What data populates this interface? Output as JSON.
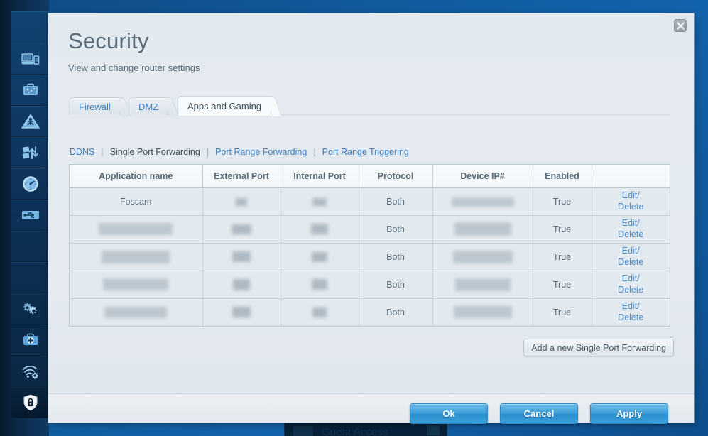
{
  "sidebar": {
    "items": [
      {
        "name": "device-list",
        "icon": "laptop-devices-icon",
        "label": "Device List"
      },
      {
        "name": "guest-access",
        "icon": "suitcase-icon",
        "label": "Guest Access"
      },
      {
        "name": "parental-controls",
        "icon": "parental-controls-icon",
        "label": "Parental Controls"
      },
      {
        "name": "media-prioritization",
        "icon": "media-prioritization-icon",
        "label": "Media Prioritization"
      },
      {
        "name": "speed-test",
        "icon": "speedometer-icon",
        "label": "Speed Test"
      },
      {
        "name": "external-storage",
        "icon": "usb-storage-icon",
        "label": "External Storage"
      },
      {
        "name": "connectivity",
        "icon": "gears-icon",
        "label": "Connectivity"
      },
      {
        "name": "troubleshooting",
        "icon": "toolkit-plus-icon",
        "label": "Troubleshooting"
      },
      {
        "name": "wireless",
        "icon": "wifi-gear-icon",
        "label": "Wireless"
      },
      {
        "name": "security",
        "icon": "shield-lock-icon",
        "label": "Security"
      }
    ],
    "active": "security"
  },
  "background": {
    "card_title": "Guest Access"
  },
  "dialog": {
    "title": "Security",
    "subtitle": "View and change router settings",
    "close_label": "×"
  },
  "tabs": [
    {
      "label": "Firewall",
      "active": false
    },
    {
      "label": "DMZ",
      "active": false
    },
    {
      "label": "Apps and Gaming",
      "active": true
    }
  ],
  "subnav": [
    {
      "label": "DDNS",
      "current": false
    },
    {
      "label": "Single Port Forwarding",
      "current": true
    },
    {
      "label": "Port Range Forwarding",
      "current": false
    },
    {
      "label": "Port Range Triggering",
      "current": false
    }
  ],
  "table": {
    "columns": [
      "Application name",
      "External Port",
      "Internal Port",
      "Protocol",
      "Device IP#",
      "Enabled",
      ""
    ],
    "rows": [
      {
        "application_name": "Foscam",
        "external_port": "",
        "internal_port": "",
        "protocol": "Both",
        "device_ip": "",
        "enabled": "True",
        "edit_label": "Edit/",
        "delete_label": "Delete",
        "redacted": [
          "external_port",
          "internal_port",
          "device_ip"
        ]
      },
      {
        "application_name": "",
        "external_port": "",
        "internal_port": "",
        "protocol": "Both",
        "device_ip": "",
        "enabled": "True",
        "edit_label": "Edit/",
        "delete_label": "Delete",
        "redacted": [
          "application_name",
          "external_port",
          "internal_port",
          "device_ip"
        ]
      },
      {
        "application_name": "",
        "external_port": "",
        "internal_port": "",
        "protocol": "Both",
        "device_ip": "",
        "enabled": "True",
        "edit_label": "Edit/",
        "delete_label": "Delete",
        "redacted": [
          "application_name",
          "external_port",
          "internal_port",
          "device_ip"
        ]
      },
      {
        "application_name": "",
        "external_port": "",
        "internal_port": "",
        "protocol": "Both",
        "device_ip": "",
        "enabled": "True",
        "edit_label": "Edit/",
        "delete_label": "Delete",
        "redacted": [
          "application_name",
          "external_port",
          "internal_port",
          "device_ip"
        ]
      },
      {
        "application_name": "",
        "external_port": "",
        "internal_port": "",
        "protocol": "Both",
        "device_ip": "",
        "enabled": "True",
        "edit_label": "Edit/",
        "delete_label": "Delete",
        "redacted": [
          "application_name",
          "external_port",
          "internal_port",
          "device_ip"
        ]
      }
    ]
  },
  "add_button": {
    "label": "Add a new Single Port Forwarding"
  },
  "footer": {
    "ok_label": "Ok",
    "cancel_label": "Cancel",
    "apply_label": "Apply"
  },
  "colors": {
    "accent_blue": "#3d7fbf",
    "button_blue": "#2b8ecd",
    "dialog_bg": "#e3eaef",
    "app_bg": "#115c9f",
    "nav_bg": "#0c2b4b",
    "text_muted": "#5b6b77"
  }
}
